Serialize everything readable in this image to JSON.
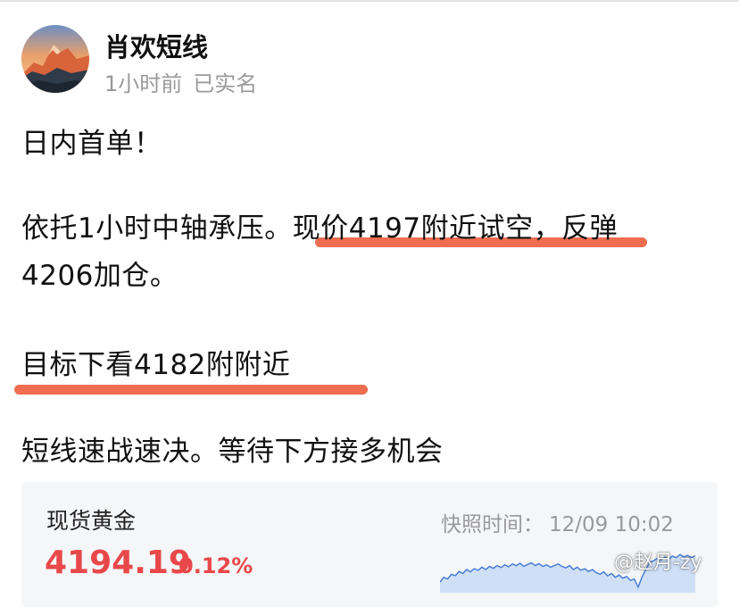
{
  "author": {
    "name": "肖欢短线",
    "time_ago": "1小时前",
    "verified": "已实名"
  },
  "post": {
    "line1": "日内首单！",
    "line2": "依托1小时中轴承压。现价4197附近试空，反弹",
    "line3": "4206加仓。",
    "line4": "目标下看4182附附近",
    "line5": "短线速战速决。等待下方接多机会"
  },
  "quote": {
    "name": "现货黄金",
    "price": "4194.19",
    "change": "0.12%",
    "snapshot_label": "快照时间：",
    "snapshot_time": "12/09 10:02",
    "trend": [
      0.82,
      0.7,
      0.74,
      0.62,
      0.66,
      0.55,
      0.6,
      0.5,
      0.56,
      0.48,
      0.52,
      0.44,
      0.5,
      0.42,
      0.47,
      0.4,
      0.45,
      0.38,
      0.43,
      0.36,
      0.4,
      0.34,
      0.42,
      0.37,
      0.33,
      0.4,
      0.35,
      0.42,
      0.38,
      0.44,
      0.4,
      0.36,
      0.42,
      0.46,
      0.4,
      0.5,
      0.44,
      0.52,
      0.48,
      0.55,
      0.5,
      0.58,
      0.62,
      0.56,
      0.66,
      0.6,
      0.7,
      0.64,
      0.72,
      0.68,
      0.78,
      0.74,
      0.95,
      0.7,
      0.5,
      0.32,
      0.28,
      0.22,
      0.26,
      0.18,
      0.24,
      0.16,
      0.2,
      0.12,
      0.18,
      0.14,
      0.2,
      0.15
    ]
  },
  "colors": {
    "price": "#e8484a",
    "highlight": "#ef6d50",
    "line": "#4a7fd6",
    "card": "#f5f6f8"
  },
  "watermark": "@赵月-zy"
}
